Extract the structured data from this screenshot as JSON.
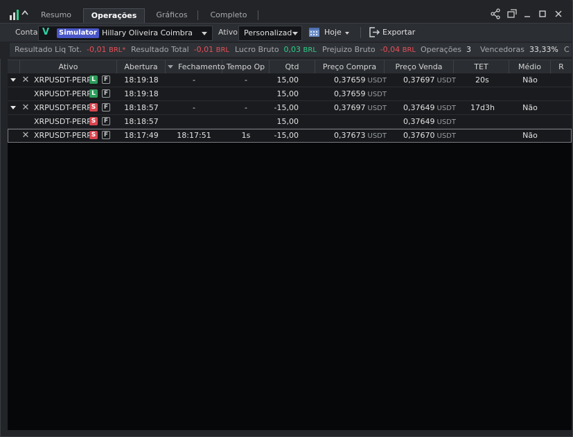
{
  "tabs": [
    {
      "label": "Resumo"
    },
    {
      "label": "Operações"
    },
    {
      "label": "Gráficos"
    },
    {
      "label": "Completo"
    }
  ],
  "active_tab": "Operações",
  "toolbar": {
    "conta_label": "Conta",
    "account_badge": "Simulator",
    "account_name": "Hillary Oliveira Coimbra",
    "ativo_label": "Ativo",
    "ativo_value": "Personalizad",
    "date_filter": "Hoje",
    "export_label": "Exportar"
  },
  "stats": [
    {
      "label": "Resultado Liq Tot.",
      "value": "-0,01",
      "unit": "BRL*",
      "tone": "neg"
    },
    {
      "label": "Resultado Total",
      "value": "-0,01",
      "unit": "BRL",
      "tone": "neg"
    },
    {
      "label": "Lucro Bruto",
      "value": "0,03",
      "unit": "BRL",
      "tone": "pos"
    },
    {
      "label": "Prejuizo Bruto",
      "value": "-0,04",
      "unit": "BRL",
      "tone": "neg"
    },
    {
      "label": "Operações",
      "value": "3",
      "unit": "",
      "tone": "plain"
    },
    {
      "label": "Vencedoras",
      "value": "33,33%",
      "unit": "",
      "tone": "plain"
    },
    {
      "label": "C",
      "value": "",
      "unit": "",
      "tone": "plain"
    }
  ],
  "columns": [
    "Ativo",
    "Abertura",
    "Fechamento",
    "Tempo Op",
    "Qtd",
    "Preço Compra",
    "Preço Venda",
    "TET",
    "Médio",
    "R"
  ],
  "rows": [
    {
      "expand": true,
      "close": true,
      "ativo": "XRPUSDT-PERP",
      "side": "L",
      "flag": "F",
      "abertura": "18:19:18",
      "fechamento": "-",
      "tempo": "-",
      "qtd": "15,00",
      "compra": "0,37659",
      "compra_unit": "USDT",
      "venda": "0,37697",
      "venda_unit": "USDT",
      "tet": "20s",
      "medio": "Não"
    },
    {
      "expand": false,
      "close": false,
      "ativo": "XRPUSDT-PERP",
      "side": "L",
      "flag": "F",
      "abertura": "18:19:18",
      "fechamento": "",
      "tempo": "",
      "qtd": "15,00",
      "compra": "0,37659",
      "compra_unit": "USDT",
      "venda": "",
      "venda_unit": "",
      "tet": "",
      "medio": ""
    },
    {
      "expand": true,
      "close": true,
      "ativo": "XRPUSDT-PERP",
      "side": "S",
      "flag": "F",
      "abertura": "18:18:57",
      "fechamento": "-",
      "tempo": "-",
      "qtd": "-15,00",
      "compra": "0,37697",
      "compra_unit": "USDT",
      "venda": "0,37649",
      "venda_unit": "USDT",
      "tet": "17d3h",
      "medio": "Não"
    },
    {
      "expand": false,
      "close": false,
      "ativo": "XRPUSDT-PERP",
      "side": "S",
      "flag": "F",
      "abertura": "18:18:57",
      "fechamento": "",
      "tempo": "",
      "qtd": "15,00",
      "compra": "",
      "compra_unit": "",
      "venda": "0,37649",
      "venda_unit": "USDT",
      "tet": "",
      "medio": ""
    },
    {
      "expand": false,
      "close": true,
      "ativo": "XRPUSDT-PERP",
      "side": "S",
      "flag": "F",
      "abertura": "18:17:49",
      "fechamento": "18:17:51",
      "tempo": "1s",
      "qtd": "-15,00",
      "compra": "0,37673",
      "compra_unit": "USDT",
      "venda": "0,37670",
      "venda_unit": "USDT",
      "tet": "",
      "medio": "Não"
    }
  ],
  "selected_row": 4,
  "colors": {
    "accent": "#4a57c8",
    "positive": "#2fd08a",
    "negative": "#ea4f58",
    "long": "#2d9d5b",
    "short": "#d9454f"
  }
}
